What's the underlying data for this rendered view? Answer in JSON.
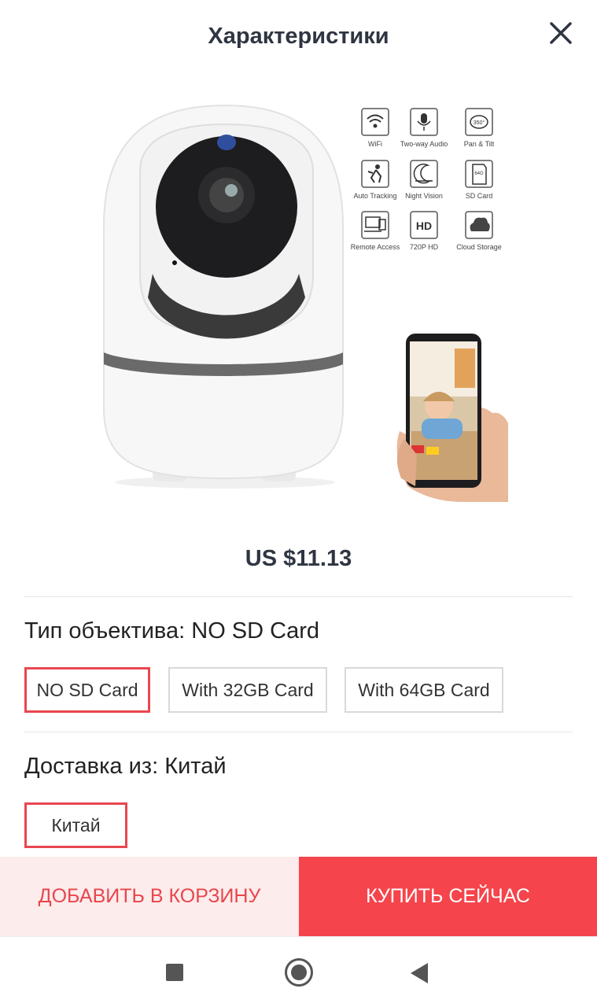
{
  "header": {
    "title": "Характеристики"
  },
  "product": {
    "price": "US $11.13",
    "features": [
      {
        "icon": "wifi-icon",
        "label": "WiFi"
      },
      {
        "icon": "microphone-icon",
        "label": "Two-way Audio"
      },
      {
        "icon": "rotate-360-icon",
        "label": "Pan & Tilt",
        "badge": "350°"
      },
      {
        "icon": "motion-tracking-icon",
        "label": "Auto Tracking"
      },
      {
        "icon": "night-vision-icon",
        "label": "Night Vision"
      },
      {
        "icon": "sd-card-icon",
        "label": "SD Card",
        "badge": "64G"
      },
      {
        "icon": "remote-access-icon",
        "label": "Remote Access"
      },
      {
        "icon": "hd-icon",
        "label": "720P HD",
        "badge": "HD"
      },
      {
        "icon": "cloud-icon",
        "label": "Cloud Storage"
      }
    ]
  },
  "lens_type": {
    "title": "Тип объектива: NO SD Card",
    "options": [
      "NO SD Card",
      "With 32GB Card",
      "With 64GB Card"
    ],
    "selected": "NO SD Card"
  },
  "ship_from": {
    "title": "Доставка из: Китай",
    "options": [
      "Китай"
    ],
    "selected": "Китай"
  },
  "actions": {
    "add_to_cart": "ДОБАВИТЬ В КОРЗИНУ",
    "buy_now": "КУПИТЬ СЕЙЧАС"
  },
  "colors": {
    "accent": "#f5444b",
    "accent_light": "#fdecec",
    "selected_border": "#e8474f",
    "title_text": "#2f3541"
  }
}
